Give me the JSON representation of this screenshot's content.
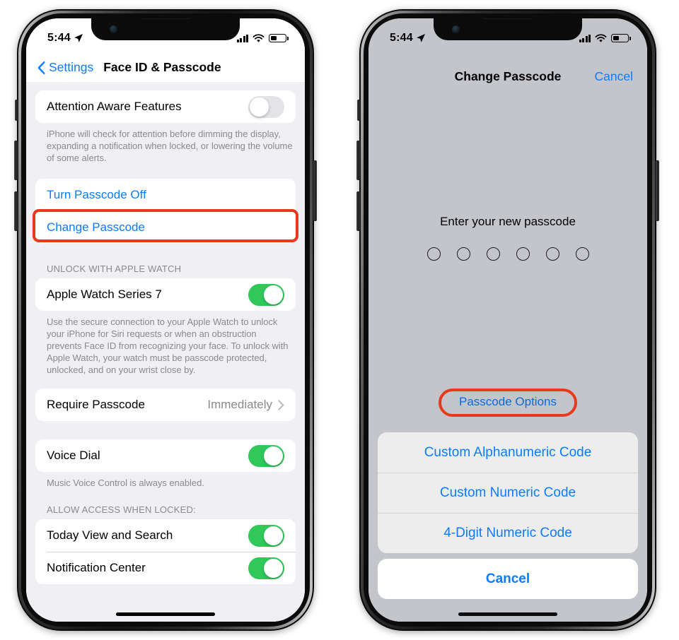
{
  "left_phone": {
    "status_bar": {
      "time": "5:44",
      "location_icon": "location-arrow-icon",
      "cellular_icon": "cellular-bars-icon",
      "wifi_icon": "wifi-icon",
      "battery_icon": "battery-icon",
      "battery_level_pct": 35
    },
    "nav": {
      "back_label": "Settings",
      "back_icon": "chevron-left-icon",
      "title": "Face ID & Passcode"
    },
    "groups": [
      {
        "rows": [
          {
            "label": "Attention Aware Features",
            "control": "toggle",
            "value": "off"
          }
        ],
        "footer": "iPhone will check for attention before dimming the display, expanding a notification when locked, or lowering the volume of some alerts."
      },
      {
        "rows": [
          {
            "label": "Turn Passcode Off",
            "control": "link"
          },
          {
            "label": "Change Passcode",
            "control": "link",
            "highlighted": true
          }
        ]
      },
      {
        "header": "UNLOCK WITH APPLE WATCH",
        "rows": [
          {
            "label": "Apple Watch Series 7",
            "control": "toggle",
            "value": "on"
          }
        ],
        "footer": "Use the secure connection to your Apple Watch to unlock your iPhone for Siri requests or when an obstruction prevents Face ID from recognizing your face. To unlock with Apple Watch, your watch must be passcode protected, unlocked, and on your wrist close by."
      },
      {
        "rows": [
          {
            "label": "Require Passcode",
            "control": "value",
            "value": "Immediately",
            "chevron_icon": "chevron-right-icon"
          }
        ]
      },
      {
        "rows": [
          {
            "label": "Voice Dial",
            "control": "toggle",
            "value": "on"
          }
        ],
        "footer": "Music Voice Control is always enabled."
      },
      {
        "header": "ALLOW ACCESS WHEN LOCKED:",
        "rows": [
          {
            "label": "Today View and Search",
            "control": "toggle",
            "value": "on"
          },
          {
            "label": "Notification Center",
            "control": "toggle",
            "value": "on"
          }
        ]
      }
    ]
  },
  "right_phone": {
    "status_bar": {
      "time": "5:44",
      "location_icon": "location-arrow-icon",
      "cellular_icon": "cellular-bars-icon",
      "wifi_icon": "wifi-icon",
      "battery_icon": "battery-icon",
      "battery_level_pct": 35
    },
    "nav": {
      "title": "Change Passcode",
      "cancel_label": "Cancel"
    },
    "prompt": "Enter your new passcode",
    "passcode_dots": 6,
    "passcode_options_label": "Passcode Options",
    "action_sheet": {
      "options": [
        "Custom Alphanumeric Code",
        "Custom Numeric Code",
        "4-Digit Numeric Code"
      ],
      "cancel_label": "Cancel"
    }
  },
  "colors": {
    "accent_blue": "#0a7cff",
    "toggle_green": "#31c85a",
    "highlight_red": "#e8391f",
    "list_background": "#efeff4",
    "dimmed_background": "#c4c5cb",
    "secondary_text": "#8a8a8e"
  }
}
